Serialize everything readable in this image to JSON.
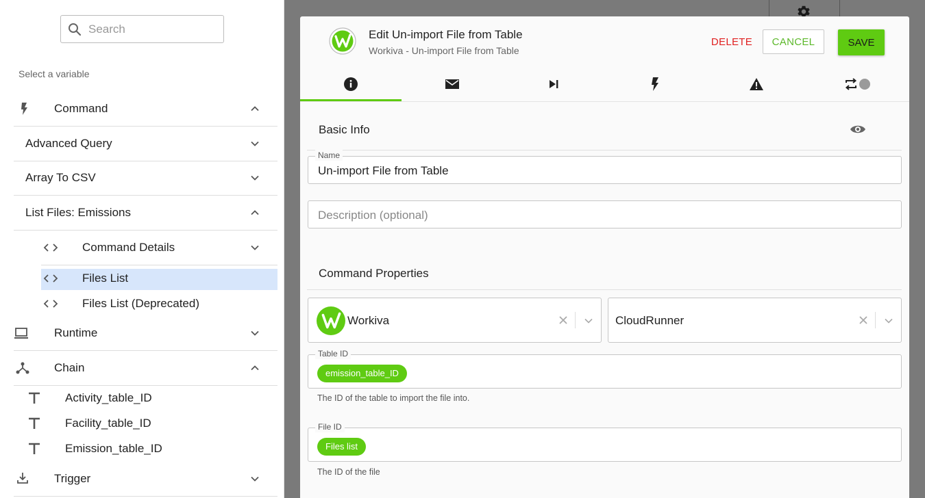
{
  "search": {
    "placeholder": "Search"
  },
  "left_panel": {
    "select_label": "Select a variable",
    "groups": [
      {
        "label": "Command",
        "icon": "lightning-icon",
        "expanded": true
      },
      {
        "label": "Advanced Query",
        "expanded": false
      },
      {
        "label": "Array To CSV",
        "expanded": false
      },
      {
        "label": "List Files: Emissions",
        "expanded": true
      },
      {
        "label": "Command Details",
        "icon": "code-icon",
        "expanded": false
      },
      {
        "label": "Files List",
        "icon": "code-icon",
        "selected": true
      },
      {
        "label": "Files List (Deprecated)",
        "icon": "code-icon"
      },
      {
        "label": "Runtime",
        "icon": "laptop-icon",
        "expanded": false
      },
      {
        "label": "Chain",
        "icon": "chain-icon",
        "expanded": true
      },
      {
        "label": "Activity_table_ID",
        "icon": "text-icon"
      },
      {
        "label": "Facility_table_ID",
        "icon": "text-icon"
      },
      {
        "label": "Emission_table_ID",
        "icon": "text-icon"
      },
      {
        "label": "Trigger",
        "icon": "trigger-icon",
        "expanded": false
      }
    ]
  },
  "dialog": {
    "title": "Edit Un-import File from Table",
    "subtitle": "Workiva - Un-import File from Table",
    "buttons": {
      "delete": "DELETE",
      "cancel": "CANCEL",
      "save": "SAVE"
    },
    "tabs": [
      {
        "icon": "info-icon",
        "active": true
      },
      {
        "icon": "mail-icon"
      },
      {
        "icon": "skip-next-icon"
      },
      {
        "icon": "lightning-icon"
      },
      {
        "icon": "warning-icon"
      },
      {
        "icon": "repeat-icon"
      }
    ],
    "basic_info": {
      "title": "Basic Info",
      "name_label": "Name",
      "name_value": "Un-import File from Table",
      "description_placeholder": "Description (optional)"
    },
    "command_properties": {
      "title": "Command Properties",
      "connector": "Workiva",
      "runner": "CloudRunner",
      "table_id": {
        "label": "Table ID",
        "chip": "emission_table_ID",
        "helper": "The ID of the table to import the file into."
      },
      "file_id": {
        "label": "File ID",
        "chip": "Files list",
        "helper": "The ID of the file"
      }
    }
  },
  "colors": {
    "accent": "#5fcb12",
    "delete": "#e02020",
    "selected_row": "#d7e6fb",
    "backdrop": "#7a7a7a"
  }
}
